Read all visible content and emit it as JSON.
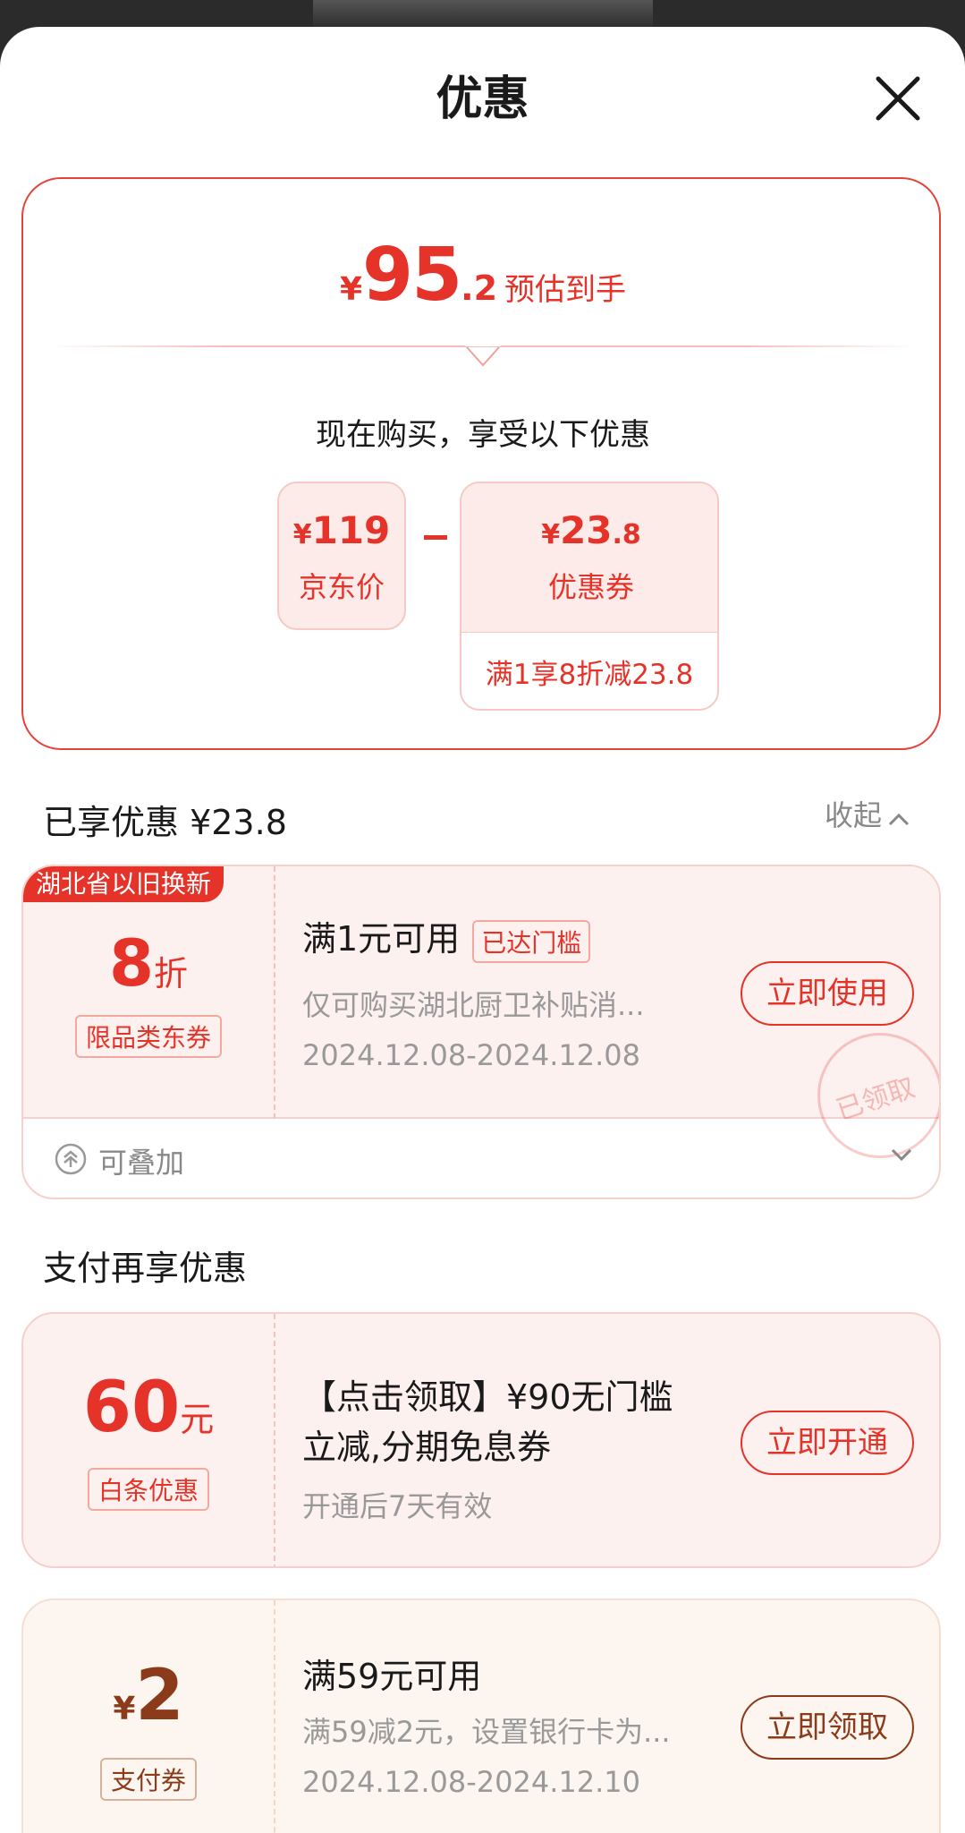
{
  "header": {
    "title": "优惠"
  },
  "summary": {
    "estimate": {
      "currency": "¥",
      "int": "95",
      "dec": ".2",
      "label": "预估到手"
    },
    "buy_now_text": "现在购买，享受以下优惠",
    "jd_price": {
      "currency": "¥",
      "value": "119",
      "label": "京东价"
    },
    "coupon": {
      "currency": "¥",
      "int": "23",
      "dec": ".8",
      "label": "优惠券",
      "desc": "满1享8折减23.8"
    }
  },
  "enjoyed": {
    "title": "已享优惠 ¥23.8",
    "collapse_label": "收起",
    "card": {
      "badge": "湖北省以旧换新",
      "amount": "8",
      "unit": "折",
      "tag": "限品类东券",
      "title": "满1元可用",
      "reached_tag": "已达门槛",
      "desc": "仅可购买湖北厨卫补贴消...",
      "date": "2024.12.08-2024.12.08",
      "button": "立即使用",
      "stamp": "已领取",
      "stack_label": "可叠加"
    }
  },
  "payment": {
    "title": "支付再享优惠",
    "cards": [
      {
        "amount": "60",
        "unit": "元",
        "tag": "白条优惠",
        "title_line1": "【点击领取】¥90无门槛",
        "title_line2": "立减,分期免息券",
        "desc": "开通后7天有效",
        "button": "立即开通"
      },
      {
        "currency": "¥",
        "amount": "2",
        "tag": "支付券",
        "title": "满59元可用",
        "desc": "满59减2元，设置银行卡为...",
        "date": "2024.12.08-2024.12.10",
        "button": "立即领取"
      }
    ]
  },
  "colors": {
    "accent": "#e5332a",
    "pay_brown": "#8b3a1a",
    "card_pink": "#fdf1f0",
    "card_cream": "#fdf6f0"
  }
}
